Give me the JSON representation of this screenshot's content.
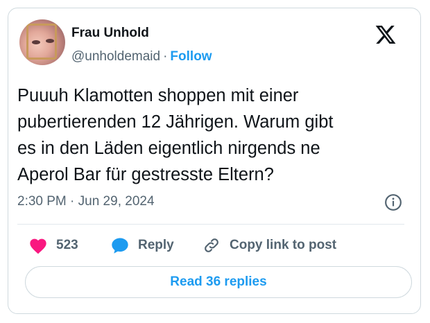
{
  "author": {
    "name": "Frau Unhold",
    "handle": "@unholdemaid",
    "separator": "·",
    "follow_label": "Follow"
  },
  "tweet": {
    "lines": [
      "Puuuh Klamotten shoppen mit einer",
      "pubertierenden 12 Jährigen. Warum gibt",
      "es in den Läden eigentlich nirgends ne",
      "Aperol Bar für gestresste Eltern?"
    ],
    "timestamp": "2:30 PM · Jun 29, 2024"
  },
  "actions": {
    "like_count": "523",
    "reply_label": "Reply",
    "copy_label": "Copy link to post"
  },
  "footer": {
    "read_replies_label": "Read 36 replies"
  },
  "colors": {
    "accent": "#1d9bf0",
    "like": "#f91880",
    "muted": "#536471",
    "text": "#0f1419",
    "border": "#cfd9de"
  },
  "icons": [
    "x-logo-icon",
    "info-icon",
    "heart-icon",
    "reply-bubble-icon",
    "link-icon"
  ]
}
